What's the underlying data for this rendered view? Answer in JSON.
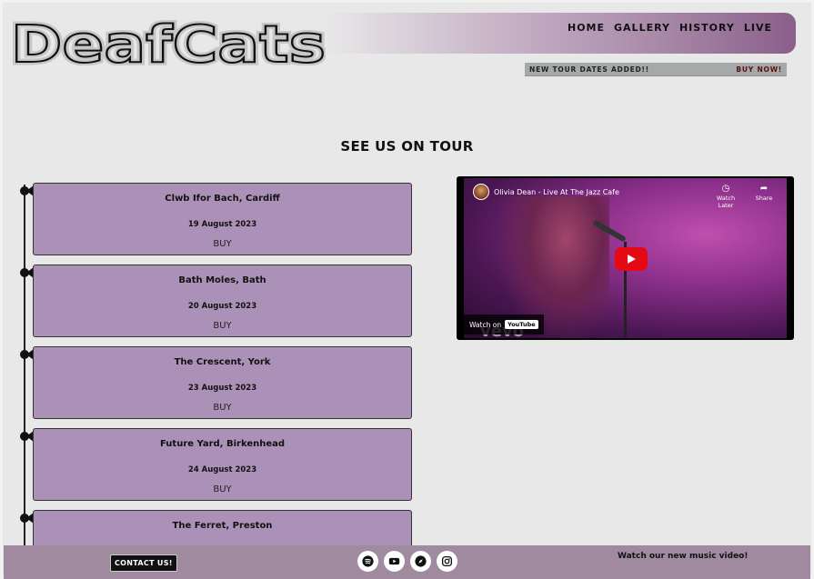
{
  "brand": {
    "logo_text": "DeafCats"
  },
  "nav": {
    "items": [
      "HOME",
      "GALLERY",
      "HISTORY",
      "LIVE"
    ]
  },
  "ticker": {
    "message": "NEW TOUR DATES ADDED!!",
    "cta": "BUY NOW!"
  },
  "tour": {
    "title": "SEE US ON TOUR",
    "dates": [
      {
        "venue": "Clwb Ifor Bach, Cardiff",
        "date": "19 August 2023",
        "action": "BUY"
      },
      {
        "venue": "Bath Moles, Bath",
        "date": "20 August 2023",
        "action": "BUY"
      },
      {
        "venue": "The Crescent, York",
        "date": "23 August 2023",
        "action": "BUY"
      },
      {
        "venue": "Future Yard, Birkenhead",
        "date": "24 August 2023",
        "action": "BUY"
      },
      {
        "venue": "The Ferret, Preston",
        "date": "",
        "action": ""
      }
    ]
  },
  "video": {
    "title": "Olivia Dean - Live At The Jazz Cafe",
    "watch_later": "Watch Later",
    "share": "Share",
    "watch_on": "Watch on",
    "youtube": "YouTube",
    "vevo": "vevo"
  },
  "footer": {
    "contact": "CONTACT US!",
    "socials": [
      "spotify-icon",
      "youtube-icon",
      "compass-icon",
      "instagram-icon"
    ],
    "music_note": "Watch our new music video!"
  }
}
